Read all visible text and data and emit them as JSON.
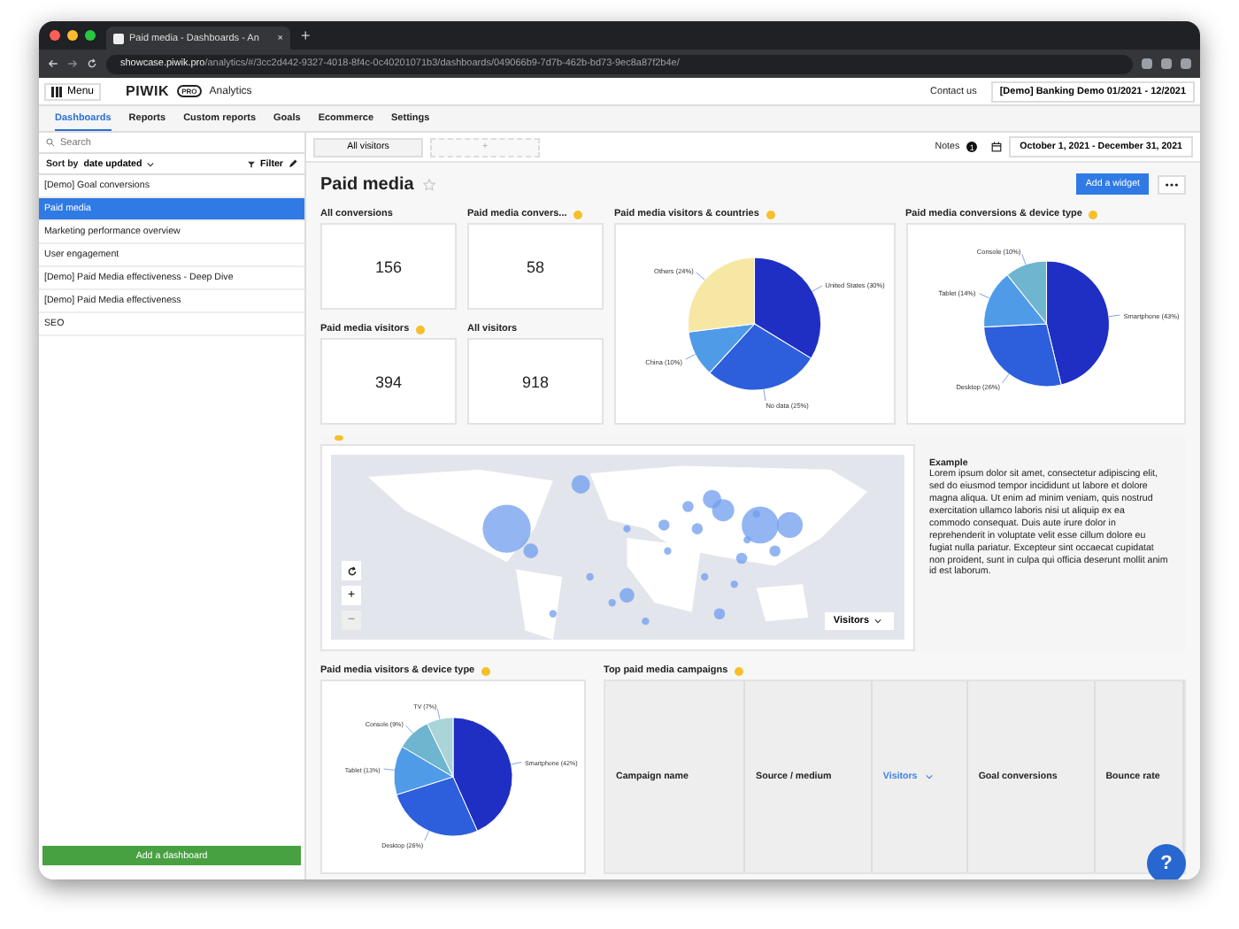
{
  "browser": {
    "tab_title": "Paid media - Dashboards - An",
    "tab_close": "×",
    "new_tab": "+",
    "url_host": "showcase.piwik.pro",
    "url_path": "/analytics/#/3cc2d442-9327-4018-8f4c-0c40201071b3/dashboards/049066b9-7d7b-462b-bd73-9ec8a87f2b4e/"
  },
  "header": {
    "menu": "Menu",
    "logo": "PIWIK",
    "logo_badge": "PRO",
    "product": "Analytics",
    "contact": "Contact us",
    "site": "[Demo] Banking Demo 01/2021 - 12/2021"
  },
  "tabs": [
    {
      "label": "Dashboards",
      "selected": true
    },
    {
      "label": "Reports",
      "selected": false
    },
    {
      "label": "Custom reports",
      "selected": false
    },
    {
      "label": "Goals",
      "selected": false
    },
    {
      "label": "Ecommerce",
      "selected": false
    },
    {
      "label": "Settings",
      "selected": false
    }
  ],
  "sidebar": {
    "search": {
      "placeholder": "Search"
    },
    "sort_label": "Sort by",
    "sort_value": "date updated",
    "filter": "Filter",
    "items": [
      {
        "label": "[Demo] Goal conversions",
        "selected": false
      },
      {
        "label": "Paid media",
        "selected": true
      },
      {
        "label": "Marketing performance overview",
        "selected": false
      },
      {
        "label": "User engagement",
        "selected": false
      },
      {
        "label": "[Demo] Paid Media effectiveness - Deep Dive",
        "selected": false
      },
      {
        "label": "[Demo] Paid Media effectiveness",
        "selected": false
      },
      {
        "label": "SEO",
        "selected": false
      }
    ],
    "add_button": "Add a dashboard"
  },
  "toolbar": {
    "segments": [
      "All visitors",
      "+"
    ],
    "notes": "Notes",
    "notes_count": "1",
    "date_range": "October 1, 2021 - December 31, 2021"
  },
  "dashboard": {
    "title": "Paid media",
    "add_widget": "Add a widget",
    "kpis": [
      {
        "title": "All conversions",
        "value": "156",
        "info": false
      },
      {
        "title": "Paid media convers...",
        "value": "58",
        "info": true
      },
      {
        "title": "Paid media visitors",
        "value": "394",
        "info": true
      },
      {
        "title": "All visitors",
        "value": "918",
        "info": false
      }
    ],
    "pies": [
      {
        "title": "Paid media visitors & countries",
        "chart_data": {
          "type": "pie",
          "categories": [
            "United States (30%)",
            "No data (25%)",
            "China (10%)",
            "Others (24%)"
          ],
          "values": [
            30,
            25,
            10,
            24
          ]
        }
      },
      {
        "title": "Paid media conversions & device type",
        "chart_data": {
          "type": "pie",
          "categories": [
            "Smartphone (43%)",
            "Desktop (26%)",
            "Tablet (14%)",
            "Console (10%)"
          ],
          "values": [
            43,
            26,
            14,
            10
          ]
        }
      }
    ],
    "map": {
      "zoom_in": "+",
      "zoom_out": "−",
      "metric": "Visitors"
    },
    "text_widget": {
      "heading": "Example",
      "body": "Lorem ipsum dolor sit amet, consectetur adipiscing elit, sed do eiusmod tempor incididunt ut labore et dolore magna aliqua. Ut enim ad minim veniam, quis nostrud exercitation ullamco laboris nisi ut aliquip ex ea commodo consequat. Duis aute irure dolor in reprehenderit in voluptate velit esse cillum dolore eu fugiat nulla pariatur. Excepteur sint occaecat cupidatat non proident, sunt in culpa qui officia deserunt mollit anim id est laborum."
    },
    "device_pie": {
      "title": "Paid media visitors & device type",
      "chart_data": {
        "type": "pie",
        "categories": [
          "Smartphone (42%)",
          "Desktop (26%)",
          "Tablet (13%)",
          "Console (9%)",
          "TV (7%)"
        ],
        "values": [
          42,
          26,
          13,
          9,
          7
        ]
      }
    },
    "table": {
      "title": "Top paid media campaigns",
      "columns": [
        {
          "label": "Campaign name",
          "sorted": false
        },
        {
          "label": "Source / medium",
          "sorted": false
        },
        {
          "label": "Visitors",
          "sorted": true
        },
        {
          "label": "Goal conversions",
          "sorted": false
        },
        {
          "label": "Bounce rate",
          "sorted": false
        }
      ]
    },
    "help": "?"
  }
}
